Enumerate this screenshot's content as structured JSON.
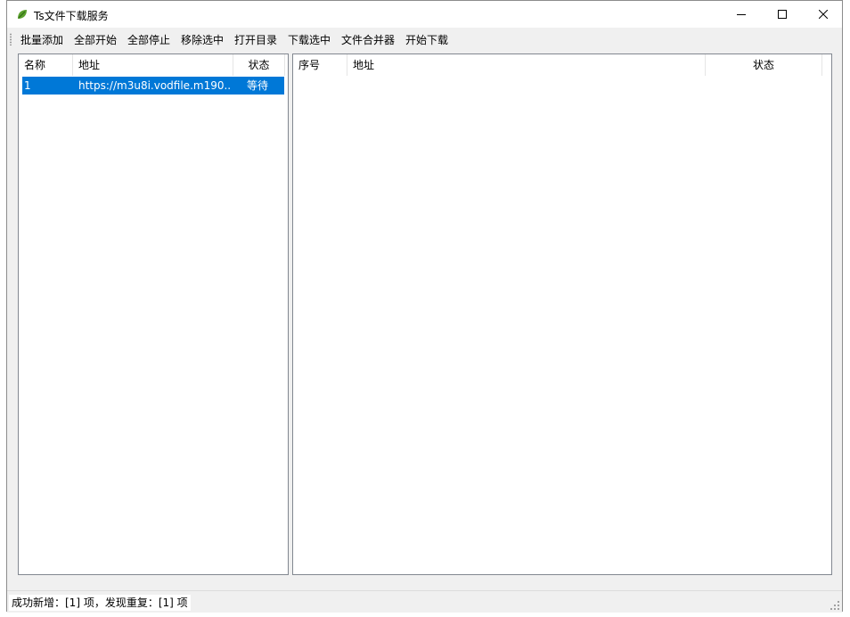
{
  "window": {
    "title": "Ts文件下载服务",
    "icon": "app-leaf-icon",
    "controls": {
      "minimize": "minimize-icon",
      "maximize": "maximize-icon",
      "close": "close-icon"
    }
  },
  "menubar": {
    "items": [
      "批量添加",
      "全部开始",
      "全部停止",
      "移除选中",
      "打开目录",
      "下载选中",
      "文件合并器",
      "开始下载"
    ]
  },
  "task_list": {
    "columns": [
      "名称",
      "地址",
      "状态"
    ],
    "rows": [
      {
        "name": "1",
        "url": "https://m3u8i.vodfile.m190...",
        "status": "等待",
        "selected": true
      }
    ]
  },
  "segment_list": {
    "columns": [
      "序号",
      "地址",
      "状态"
    ],
    "rows": []
  },
  "statusbar": {
    "message": "成功新增：[1] 项，发现重复：[1] 项"
  },
  "colors": {
    "selection": "#0078d7",
    "window_bg": "#f0f0f0",
    "panel_border": "#828790",
    "icon_green": "#4a8f2a"
  }
}
